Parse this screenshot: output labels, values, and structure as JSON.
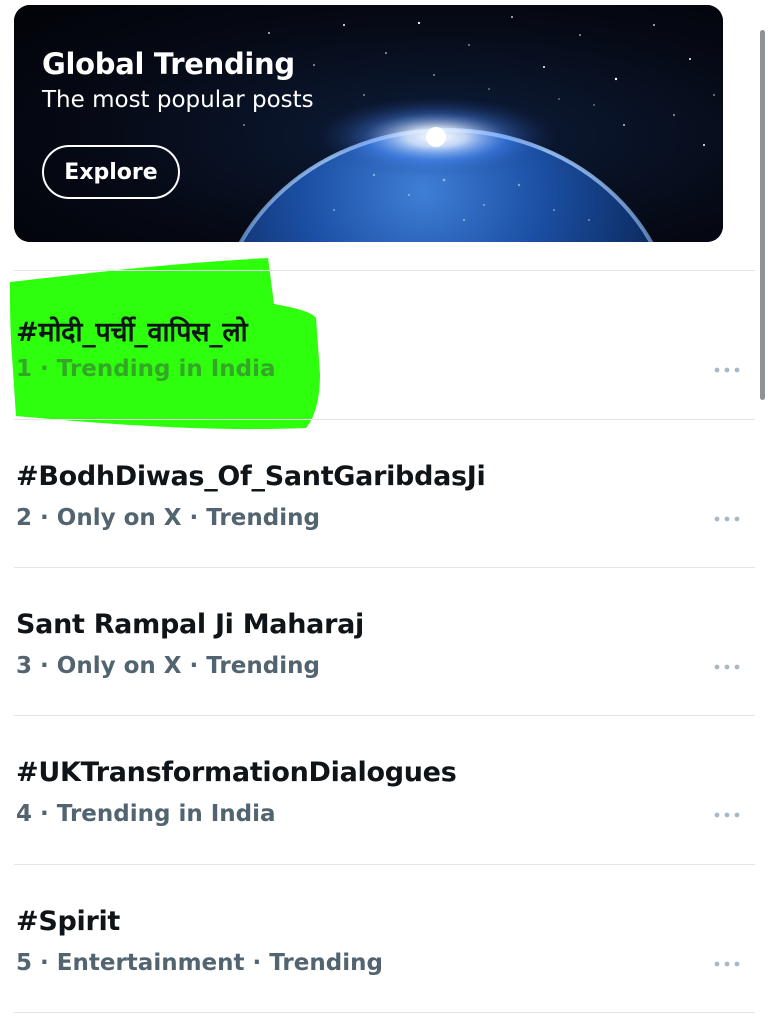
{
  "banner": {
    "title": "Global Trending",
    "subtitle": "The most popular posts",
    "explore_label": "Explore",
    "image_icon": "earth-from-space-image"
  },
  "trends": [
    {
      "title": "#मोदी_पर्ची_वापिस_लो",
      "rank": "1",
      "meta": "Trending in India",
      "highlighted": true
    },
    {
      "title": "#BodhDiwas_Of_SantGaribdasJi",
      "rank": "2",
      "meta": "Only on X · Trending",
      "highlighted": false
    },
    {
      "title": "Sant Rampal Ji Maharaj",
      "rank": "3",
      "meta": "Only on X · Trending",
      "highlighted": false
    },
    {
      "title": "#UKTransformationDialogues",
      "rank": "4",
      "meta": "Trending in India",
      "highlighted": false
    },
    {
      "title": "#Spirit",
      "rank": "5",
      "meta": "Entertainment · Trending",
      "highlighted": false
    }
  ],
  "meta_separator": " · ",
  "colors": {
    "text_primary": "#0f1419",
    "text_secondary": "#536471",
    "highlight": "#22ff00",
    "divider": "#e3e6e9"
  },
  "icons": {
    "more": "more-horizontal-icon"
  }
}
